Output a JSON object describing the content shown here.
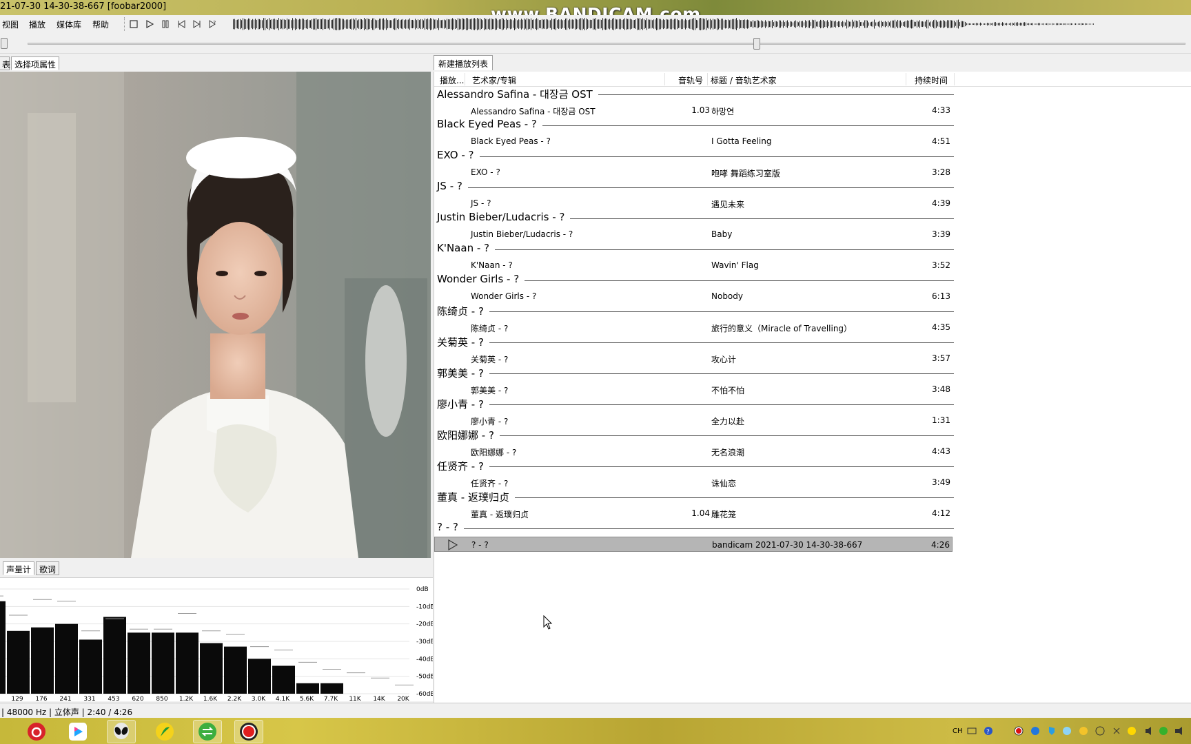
{
  "window": {
    "title": "21-07-30 14-30-38-667  [foobar2000]",
    "watermark": "www.BANDICAM.com"
  },
  "menu": {
    "items": [
      {
        "label": "视图"
      },
      {
        "label": "播放"
      },
      {
        "label": "媒体库"
      },
      {
        "label": "帮助"
      }
    ]
  },
  "toolbar": {
    "buttons": [
      "stop-icon",
      "play-icon",
      "pause-icon",
      "previous-icon",
      "next-icon",
      "random-icon"
    ]
  },
  "seekbar": {
    "position_fraction": 0.63
  },
  "left_panel": {
    "tabs": [
      {
        "label": "表"
      },
      {
        "label": "选择项属性"
      }
    ],
    "bottom_tabs": [
      {
        "label": "声量计"
      },
      {
        "label": "歌词"
      }
    ]
  },
  "spectrum": {
    "db_labels": [
      "0dB",
      "-10dB",
      "-20dB",
      "-30dB",
      "-40dB",
      "-50dB",
      "-60dB"
    ],
    "freq_labels": [
      "129",
      "176",
      "241",
      "331",
      "453",
      "620",
      "850",
      "1.2K",
      "1.6K",
      "2.2K",
      "3.0K",
      "4.1K",
      "5.6K",
      "7.7K",
      "11K",
      "14K",
      "20K"
    ],
    "bar_levels_db": [
      -7,
      -24,
      -22,
      -20,
      -29,
      -16,
      -25,
      -25,
      -25,
      -31,
      -33,
      -40,
      -44,
      -54,
      -54,
      -60,
      -60,
      -60
    ],
    "peak_levels_db": [
      -4,
      -15,
      -6,
      -7,
      -24,
      -17,
      -23,
      -23,
      -14,
      -24,
      -26,
      -33,
      -35,
      -42,
      -46,
      -48,
      -51,
      -55
    ]
  },
  "playlist": {
    "tab_label": "新建播放列表",
    "columns": {
      "playing": "播放...",
      "artist_album": "艺术家/专辑",
      "track_no": "音轨号",
      "title_artist": "标题 / 音轨艺术家",
      "duration": "持续时间"
    },
    "groups": [
      {
        "header": "Alessandro Safina - 대장금 OST",
        "tracks": [
          {
            "artist": "Alessandro Safina - 대장금 OST",
            "num": "1.03",
            "title": "하망연",
            "duration": "4:33"
          }
        ]
      },
      {
        "header": "Black Eyed Peas - ?",
        "tracks": [
          {
            "artist": "Black Eyed Peas - ?",
            "num": "",
            "title": "I Gotta Feeling",
            "duration": "4:51"
          }
        ]
      },
      {
        "header": "EXO - ?",
        "tracks": [
          {
            "artist": "EXO - ?",
            "num": "",
            "title": "咆哮 舞蹈练习室版",
            "duration": "3:28"
          }
        ]
      },
      {
        "header": "JS - ?",
        "tracks": [
          {
            "artist": "JS - ?",
            "num": "",
            "title": "遇见未来",
            "duration": "4:39"
          }
        ]
      },
      {
        "header": "Justin Bieber/Ludacris - ?",
        "tracks": [
          {
            "artist": "Justin Bieber/Ludacris - ?",
            "num": "",
            "title": "Baby",
            "duration": "3:39"
          }
        ]
      },
      {
        "header": "K'Naan - ?",
        "tracks": [
          {
            "artist": "K'Naan - ?",
            "num": "",
            "title": "Wavin' Flag",
            "duration": "3:52"
          }
        ]
      },
      {
        "header": "Wonder Girls - ?",
        "tracks": [
          {
            "artist": "Wonder Girls - ?",
            "num": "",
            "title": "Nobody",
            "duration": "6:13"
          }
        ]
      },
      {
        "header": "陈绮贞 - ?",
        "tracks": [
          {
            "artist": "陈绮贞 - ?",
            "num": "",
            "title": "旅行的意义（Miracle of Travelling）",
            "duration": "4:35"
          }
        ]
      },
      {
        "header": "关菊英 - ?",
        "tracks": [
          {
            "artist": "关菊英 - ?",
            "num": "",
            "title": "攻心计",
            "duration": "3:57"
          }
        ]
      },
      {
        "header": "郭美美 - ?",
        "tracks": [
          {
            "artist": "郭美美 - ?",
            "num": "",
            "title": "不怕不怕",
            "duration": "3:48"
          }
        ]
      },
      {
        "header": "廖小青 - ?",
        "tracks": [
          {
            "artist": "廖小青 - ?",
            "num": "",
            "title": "全力以赴",
            "duration": "1:31"
          }
        ]
      },
      {
        "header": "欧阳娜娜 - ?",
        "tracks": [
          {
            "artist": "欧阳娜娜 - ?",
            "num": "",
            "title": "无名浪潮",
            "duration": "4:43"
          }
        ]
      },
      {
        "header": "任贤齐 - ?",
        "tracks": [
          {
            "artist": "任贤齐 - ?",
            "num": "",
            "title": "诛仙恋",
            "duration": "3:49"
          }
        ]
      },
      {
        "header": "董真 - 返璞归贞",
        "tracks": [
          {
            "artist": "董真 - 返璞归贞",
            "num": "1.04",
            "title": "雕花笼",
            "duration": "4:12"
          }
        ]
      },
      {
        "header": "? - ?",
        "tracks": [
          {
            "artist": "? - ?",
            "num": "",
            "title": "bandicam 2021-07-30 14-30-38-667",
            "duration": "4:26",
            "playing": true
          }
        ]
      }
    ]
  },
  "status": {
    "text": "| 48000 Hz | 立体声 | 2:40 / 4:26"
  },
  "taskbar": {
    "apps": [
      "netease-music-icon",
      "youku-icon",
      "foobar-alien-icon",
      "sogou-icon",
      "refresh-arrows-icon",
      "bandicam-record-icon"
    ],
    "tray_lang": "CH"
  },
  "colors": {
    "playing_row": "#b5b5b5",
    "spectrum_bar": "#0a0a0a",
    "titlebar": "#b9b052"
  }
}
